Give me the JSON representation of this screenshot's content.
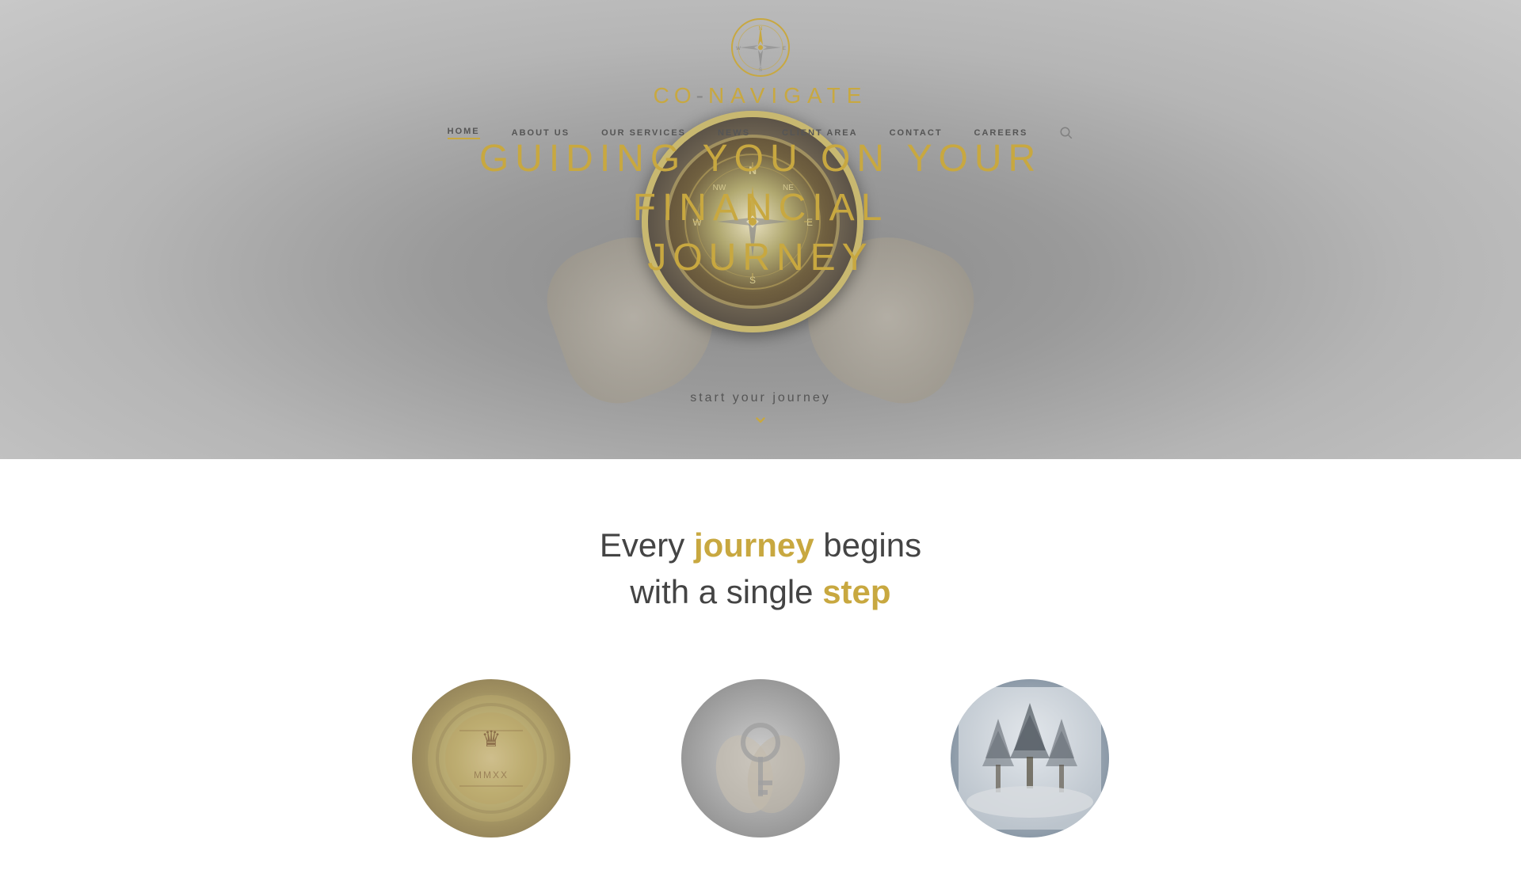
{
  "site": {
    "name": "CO-NAVIGATE",
    "logo_text": "CO-NAVIGATE"
  },
  "nav": {
    "items": [
      {
        "id": "home",
        "label": "HOME",
        "active": true
      },
      {
        "id": "about",
        "label": "ABOUT US",
        "active": false
      },
      {
        "id": "services",
        "label": "OUR SERVICES",
        "active": false
      },
      {
        "id": "news",
        "label": "NEWS",
        "active": false
      },
      {
        "id": "client",
        "label": "CLIENT AREA",
        "active": false
      },
      {
        "id": "contact",
        "label": "CONTACT",
        "active": false
      },
      {
        "id": "careers",
        "label": "CAREERS",
        "active": false
      }
    ]
  },
  "hero": {
    "title_line1": "GUIDING YOU ON YOUR FINANCIAL",
    "title_line2": "JOURNEY",
    "cta_text": "start your journey"
  },
  "content": {
    "tagline_line1_before": "Every ",
    "tagline_line1_highlight": "journey",
    "tagline_line1_after": " begins",
    "tagline_line2_before": "with a single ",
    "tagline_line2_highlight": "step"
  },
  "colors": {
    "gold": "#c8a840",
    "dark_text": "#444444",
    "nav_text": "#555555",
    "hero_bg": "#b0b0b0"
  }
}
